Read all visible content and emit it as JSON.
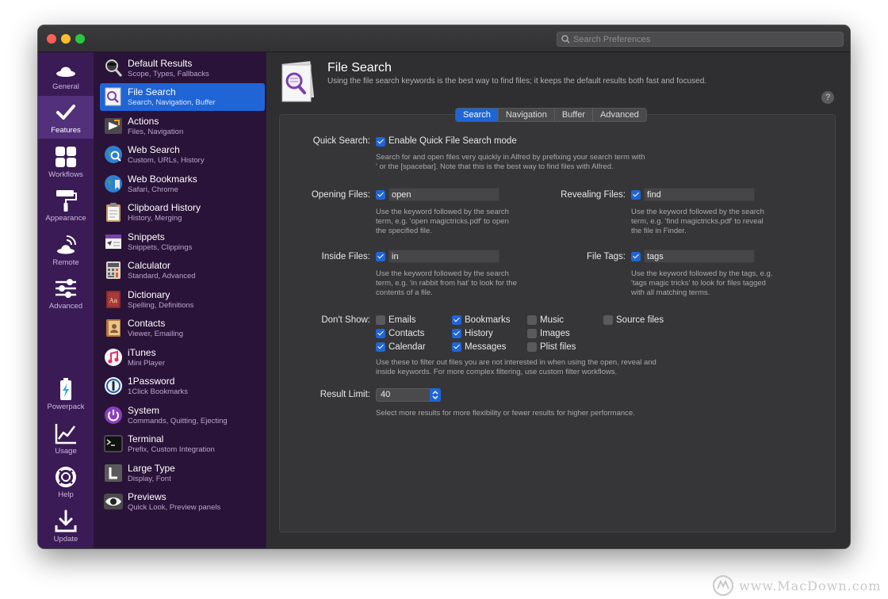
{
  "window": {
    "search_placeholder": "Search Preferences"
  },
  "left_nav": {
    "items": [
      {
        "label": "General",
        "icon": "hat-icon"
      },
      {
        "label": "Features",
        "icon": "checkmark-icon"
      },
      {
        "label": "Workflows",
        "icon": "grid-icon"
      },
      {
        "label": "Appearance",
        "icon": "paint-roller-icon"
      },
      {
        "label": "Remote",
        "icon": "remote-hat-icon"
      },
      {
        "label": "Advanced",
        "icon": "sliders-icon"
      },
      {
        "label": "Powerpack",
        "icon": "battery-bolt-icon"
      },
      {
        "label": "Usage",
        "icon": "chart-line-icon"
      },
      {
        "label": "Help",
        "icon": "lifebuoy-icon"
      },
      {
        "label": "Update",
        "icon": "download-icon"
      }
    ],
    "active": "Features"
  },
  "features": {
    "items": [
      {
        "title": "Default Results",
        "subtitle": "Scope, Types, Fallbacks",
        "icon": "magnifier-hat-icon"
      },
      {
        "title": "File Search",
        "subtitle": "Search, Navigation, Buffer",
        "icon": "file-search-icon"
      },
      {
        "title": "Actions",
        "subtitle": "Files, Navigation",
        "icon": "actions-icon"
      },
      {
        "title": "Web Search",
        "subtitle": "Custom, URLs, History",
        "icon": "globe-search-icon"
      },
      {
        "title": "Web Bookmarks",
        "subtitle": "Safari, Chrome",
        "icon": "globe-bookmarks-icon"
      },
      {
        "title": "Clipboard History",
        "subtitle": "History, Merging",
        "icon": "clipboard-icon"
      },
      {
        "title": "Snippets",
        "subtitle": "Snippets, Clippings",
        "icon": "snippets-icon"
      },
      {
        "title": "Calculator",
        "subtitle": "Standard, Advanced",
        "icon": "calculator-icon"
      },
      {
        "title": "Dictionary",
        "subtitle": "Spelling, Definitions",
        "icon": "dictionary-icon"
      },
      {
        "title": "Contacts",
        "subtitle": "Viewer, Emailing",
        "icon": "contacts-icon"
      },
      {
        "title": "iTunes",
        "subtitle": "Mini Player",
        "icon": "music-note-icon"
      },
      {
        "title": "1Password",
        "subtitle": "1Click Bookmarks",
        "icon": "onepassword-icon"
      },
      {
        "title": "System",
        "subtitle": "Commands, Quitting, Ejecting",
        "icon": "power-icon"
      },
      {
        "title": "Terminal",
        "subtitle": "Prefix, Custom Integration",
        "icon": "terminal-icon"
      },
      {
        "title": "Large Type",
        "subtitle": "Display, Font",
        "icon": "large-type-icon"
      },
      {
        "title": "Previews",
        "subtitle": "Quick Look, Preview panels",
        "icon": "eye-icon"
      }
    ],
    "active": "File Search"
  },
  "header": {
    "title": "File Search",
    "subtitle": "Using the file search keywords is the best way to find files; it keeps the default results both fast and focused.",
    "help": "?"
  },
  "tabs": [
    {
      "label": "Search",
      "active": true
    },
    {
      "label": "Navigation",
      "active": false
    },
    {
      "label": "Buffer",
      "active": false
    },
    {
      "label": "Advanced",
      "active": false
    }
  ],
  "quick_search": {
    "label": "Quick Search:",
    "checkbox_label": "Enable Quick File Search mode",
    "checked": true,
    "help": [
      "Search for and open files very quickly in Alfred by prefixing your search term with",
      "' or the [spacebar]. Note that this is the best way to find files with Alfred."
    ]
  },
  "opening_files": {
    "label": "Opening Files:",
    "checked": true,
    "value": "open",
    "help": [
      "Use the keyword followed by the search",
      "term, e.g. 'open magictricks.pdf' to open",
      "the specified file."
    ]
  },
  "revealing_files": {
    "label": "Revealing Files:",
    "checked": true,
    "value": "find",
    "help": [
      "Use the keyword followed by the search",
      "term, e.g. 'find magictricks.pdf' to reveal",
      "the file in Finder."
    ]
  },
  "inside_files": {
    "label": "Inside Files:",
    "checked": true,
    "value": "in",
    "help": [
      "Use the keyword followed by the search",
      "term, e.g. 'in rabbit from hat' to look for the",
      "contents of a file."
    ]
  },
  "file_tags": {
    "label": "File Tags:",
    "checked": true,
    "value": "tags",
    "help": [
      "Use the keyword followed by the tags, e.g.",
      "'tags magic tricks' to look for files tagged",
      "with all matching terms."
    ]
  },
  "dont_show": {
    "label": "Don't Show:",
    "options": [
      {
        "label": "Emails",
        "checked": false
      },
      {
        "label": "Contacts",
        "checked": true
      },
      {
        "label": "Calendar",
        "checked": true
      },
      {
        "label": "Bookmarks",
        "checked": true
      },
      {
        "label": "History",
        "checked": true
      },
      {
        "label": "Messages",
        "checked": true
      },
      {
        "label": "Music",
        "checked": false
      },
      {
        "label": "Images",
        "checked": false
      },
      {
        "label": "Plist files",
        "checked": false
      },
      {
        "label": "Source files",
        "checked": false
      }
    ],
    "help": [
      "Use these to filter out files you are not interested in when using the open, reveal and",
      "inside keywords. For more complex filtering, use custom filter workflows."
    ]
  },
  "result_limit": {
    "label": "Result Limit:",
    "value": "40",
    "help": "Select more results for more flexibility or fewer results for higher performance."
  },
  "watermark": "www.MacDown.com",
  "colors": {
    "accent": "#1f65d6",
    "sidebar": "#3a1b56",
    "feature_list": "#2a1338",
    "window_bg": "#2f2f31"
  }
}
